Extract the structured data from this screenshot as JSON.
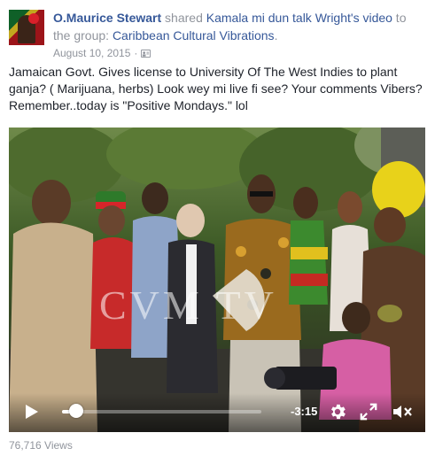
{
  "post": {
    "author": "O.Maurice Stewart",
    "action_1": " shared ",
    "shared_from": "Kamala mi dun talk Wright",
    "action_2": "'s video",
    "action_3": " to the group: ",
    "group": "Caribbean Cultural Vibrations",
    "period": ".",
    "date": "August 10, 2015",
    "separator": "·",
    "privacy_icon": "group-privacy-icon",
    "body": "Jamaican Govt. Gives license to University Of The West Indies to plant ganja? ( Marijuana, herbs) Look wey mi live fi see? Your comments Vibers? Remember..today is \"Positive Mondays.\" lol"
  },
  "video": {
    "watermark": "CVM  TV",
    "time_remaining": "-3:15",
    "progress": 0.07,
    "icons": {
      "play": "play-icon",
      "settings": "gear-icon",
      "fullscreen": "expand-icon",
      "volume": "mute-icon"
    }
  },
  "footer": {
    "views": "76,716 Views"
  },
  "colors": {
    "link": "#365899",
    "meta": "#90949c",
    "text": "#1d2129"
  }
}
